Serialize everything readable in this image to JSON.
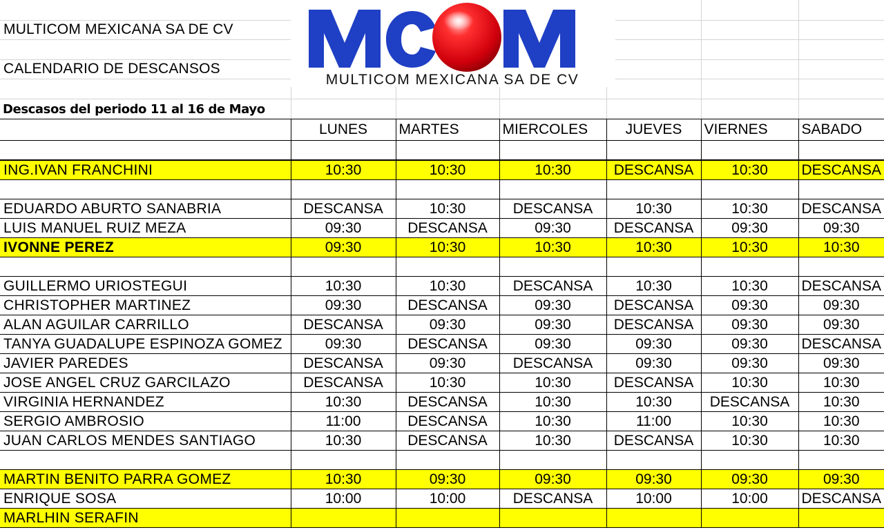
{
  "header": {
    "company": "MULTICOM MEXICANA SA DE CV",
    "title": "CALENDARIO DE DESCANSOS",
    "period": "Descasos del periodo 11  al 16 de Mayo"
  },
  "logo": {
    "letters": "MCOM",
    "subtitle": "MULTICOM MEXICANA SA DE CV",
    "colors": {
      "letters": "#1f3fc4",
      "ball": "#e3000f"
    }
  },
  "days": [
    "LUNES",
    "MARTES",
    "MIERCOLES",
    "JUEVES",
    "VIERNES",
    "SABADO"
  ],
  "highlight_color": "#ffff00",
  "rows": [
    {
      "gap": true
    },
    {
      "name": "ING.IVAN FRANCHINI",
      "highlight": true,
      "values": [
        "10:30",
        "10:30",
        "10:30",
        "DESCANSA",
        "10:30",
        "DESCANSA"
      ]
    },
    {
      "gap": true
    },
    {
      "name": "EDUARDO ABURTO SANABRIA",
      "values": [
        "DESCANSA",
        "10:30",
        "DESCANSA",
        "10:30",
        "10:30",
        "DESCANSA"
      ]
    },
    {
      "name": "LUIS MANUEL RUIZ MEZA",
      "values": [
        "09:30",
        "DESCANSA",
        "09:30",
        "DESCANSA",
        "09:30",
        "09:30"
      ]
    },
    {
      "name": "IVONNE PEREZ",
      "highlight": true,
      "bold": true,
      "values": [
        "09:30",
        "10:30",
        "10:30",
        "10:30",
        "10:30",
        "10:30"
      ]
    },
    {
      "gap": true
    },
    {
      "name": "GUILLERMO URIOSTEGUI",
      "values": [
        "10:30",
        "10:30",
        "DESCANSA",
        "10:30",
        "10:30",
        "DESCANSA"
      ]
    },
    {
      "name": "CHRISTOPHER MARTINEZ",
      "values": [
        "09:30",
        "DESCANSA",
        "09:30",
        "DESCANSA",
        "09:30",
        "09:30"
      ]
    },
    {
      "name": "ALAN AGUILAR CARRILLO",
      "values": [
        "DESCANSA",
        "09:30",
        "09:30",
        "DESCANSA",
        "09:30",
        "09:30"
      ]
    },
    {
      "name": "TANYA GUADALUPE ESPINOZA GOMEZ",
      "values": [
        "09:30",
        "DESCANSA",
        "09:30",
        "09:30",
        "09:30",
        "DESCANSA"
      ]
    },
    {
      "name": "JAVIER PAREDES",
      "values": [
        "DESCANSA",
        "09:30",
        "DESCANSA",
        "09:30",
        "09:30",
        "09:30"
      ]
    },
    {
      "name": "JOSE ANGEL CRUZ GARCILAZO",
      "values": [
        "DESCANSA",
        "10:30",
        "10:30",
        "DESCANSA",
        "10:30",
        "10:30"
      ]
    },
    {
      "name": "VIRGINIA HERNANDEZ",
      "values": [
        "10:30",
        "DESCANSA",
        "10:30",
        "10:30",
        "DESCANSA",
        "10:30"
      ]
    },
    {
      "name": "SERGIO AMBROSIO",
      "values": [
        "11:00",
        "DESCANSA",
        "10:30",
        "11:00",
        "10:30",
        "10:30"
      ]
    },
    {
      "name": "JUAN CARLOS MENDES SANTIAGO",
      "values": [
        "10:30",
        "DESCANSA",
        "10:30",
        "DESCANSA",
        "10:30",
        "10:30"
      ]
    },
    {
      "gap": true
    },
    {
      "name": "MARTIN BENITO PARRA GOMEZ",
      "highlight": true,
      "values": [
        "10:30",
        "09:30",
        "09:30",
        "09:30",
        "09:30",
        "09:30"
      ]
    },
    {
      "name": "ENRIQUE SOSA",
      "values": [
        "10:00",
        "10:00",
        "DESCANSA",
        "10:00",
        "10:00",
        "DESCANSA"
      ]
    },
    {
      "name": "MARLHIN SERAFIN",
      "highlight": true,
      "values": [
        "",
        "",
        "",
        "",
        "",
        ""
      ]
    }
  ]
}
